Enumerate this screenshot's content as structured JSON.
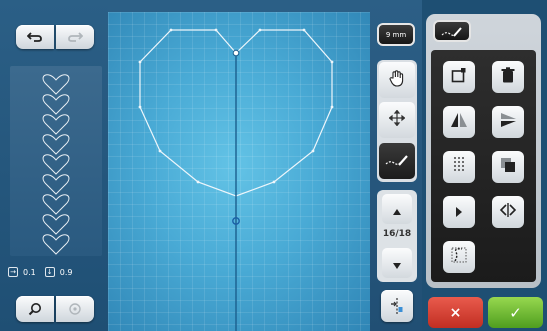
{
  "stitch_width": "9 mm",
  "pattern_counter": "16/18",
  "info": {
    "offset_value": "0.1",
    "length_value": "0.9"
  },
  "colors": {
    "canvas": "#3fa4cf",
    "cancel": "#d8463a",
    "confirm": "#6fbf2f",
    "active_tool": "#1c1c1c"
  },
  "icons": {
    "undo": "undo-arrow-icon",
    "redo": "redo-arrow-icon",
    "zoom": "magnifier-icon",
    "center": "target-icon",
    "move_hand": "hand-icon",
    "move_pattern": "move-arrows-icon",
    "stitch_edit": "stitch-line-icon",
    "arrow_up": "arrow-up-icon",
    "arrow_down": "arrow-down-icon",
    "start_point": "start-point-icon",
    "add_point": "add-point-icon",
    "delete": "trash-icon",
    "mirror_h": "mirror-horizontal-icon",
    "mirror_v": "mirror-vertical-icon",
    "stitch_type": "dotted-grid-icon",
    "duplicate": "duplicate-icon",
    "forward": "forward-icon",
    "width": "width-icon",
    "section": "section-icon",
    "cancel": "x-icon",
    "confirm": "check-icon"
  },
  "labels": {
    "cancel": "×",
    "confirm": "✓"
  }
}
